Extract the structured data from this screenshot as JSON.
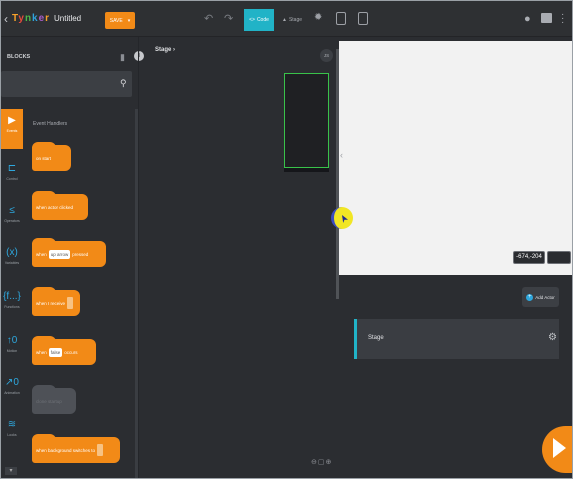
{
  "topbar": {
    "logo": [
      "T",
      "y",
      "n",
      "k",
      "e",
      "r"
    ],
    "project_title": "Untitled",
    "save_label": "SAVE",
    "save_caret": "▾",
    "tab_code": "Code",
    "tab_stage": "Stage",
    "code_glyph": "<>",
    "stage_glyph": "▲"
  },
  "blocks_panel": {
    "title": "BLOCKS",
    "search_placeholder": "",
    "section": "Event Handlers"
  },
  "categories": [
    {
      "label": "Events",
      "glyph": "▶"
    },
    {
      "label": "Control",
      "glyph": "⊏"
    },
    {
      "label": "Operators",
      "glyph": "≤"
    },
    {
      "label": "Variables",
      "glyph": "(x)"
    },
    {
      "label": "Functions",
      "glyph": "{f...}"
    },
    {
      "label": "Motion",
      "glyph": "↑0"
    },
    {
      "label": "Animation",
      "glyph": "↗0"
    },
    {
      "label": "Looks",
      "glyph": "≋"
    }
  ],
  "blocks": [
    {
      "text": "on start"
    },
    {
      "text": "when actor clicked"
    },
    {
      "pre": "when",
      "slot": "up arrow",
      "post": "pressed"
    },
    {
      "pre": "when I receive"
    },
    {
      "pre": "when",
      "slot": "false",
      "post": "occurs"
    },
    {
      "text": "clone startup"
    },
    {
      "pre": "when background switches to"
    }
  ],
  "canvas": {
    "breadcrumb": "Stage",
    "breadcrumb_caret": "›",
    "js_label": "JS",
    "zoom_controls": "⊖▢⊕"
  },
  "stage_panel": {
    "coords": "-674,-204",
    "add_actor_label": "Add Actor",
    "stage_row_label": "Stage"
  },
  "colors": {
    "accent_orange": "#f28a17",
    "accent_teal": "#21b3c7",
    "accent_blue": "#2ea7dd",
    "stage_border_green": "#39c24a"
  }
}
